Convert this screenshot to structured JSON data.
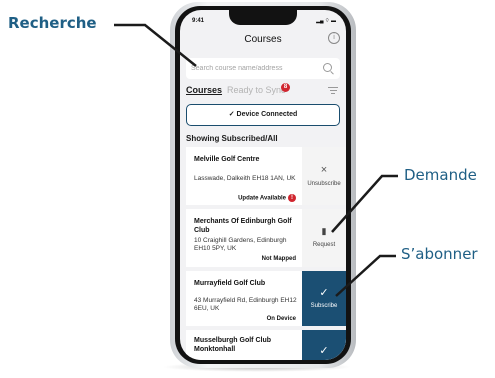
{
  "callouts": {
    "search": "Recherche",
    "request": "Demande",
    "subscribe": "S’abonner"
  },
  "status_bar": {
    "time": "9:41",
    "icons": "▂▄ ⌔ ▬"
  },
  "header": {
    "title": "Courses",
    "info_icon": "info-icon",
    "info_glyph": "i"
  },
  "search": {
    "placeholder": "Search course name/address",
    "value": ""
  },
  "tabs": [
    {
      "label": "Courses",
      "active": true
    },
    {
      "label": "Ready to Sync",
      "active": false,
      "badge": "8"
    }
  ],
  "device_status": {
    "label": "✓ Device Connected"
  },
  "list": {
    "title": "Showing Subscribed/All",
    "courses": [
      {
        "name": "Melville Golf Centre",
        "address": "Lasswade, Dalkeith EH18 1AN, UK",
        "status": "Update Available",
        "status_alert": "!",
        "action_icon": "×",
        "action_label": "Unsubscribe"
      },
      {
        "name": "Merchants Of Edinburgh Golf Club",
        "address": "10 Craighill Gardens, Edinburgh EH10 5PY, UK",
        "status": "Not Mapped",
        "action_icon": "▮",
        "action_label": "Request"
      },
      {
        "name": "Murrayfield Golf Club",
        "address": "43 Murrayfield Rd, Edinburgh EH12 6EU, UK",
        "status": "On Device",
        "action_icon": "✓",
        "action_label": "Subscribe"
      },
      {
        "name": "Musselburgh Golf Club Monktonhall",
        "address": "",
        "status": "",
        "action_icon": "✓",
        "action_label": ""
      }
    ]
  },
  "colors": {
    "accent": "#1b4f73",
    "callout": "#1f5f85",
    "alert": "#d0262f"
  }
}
